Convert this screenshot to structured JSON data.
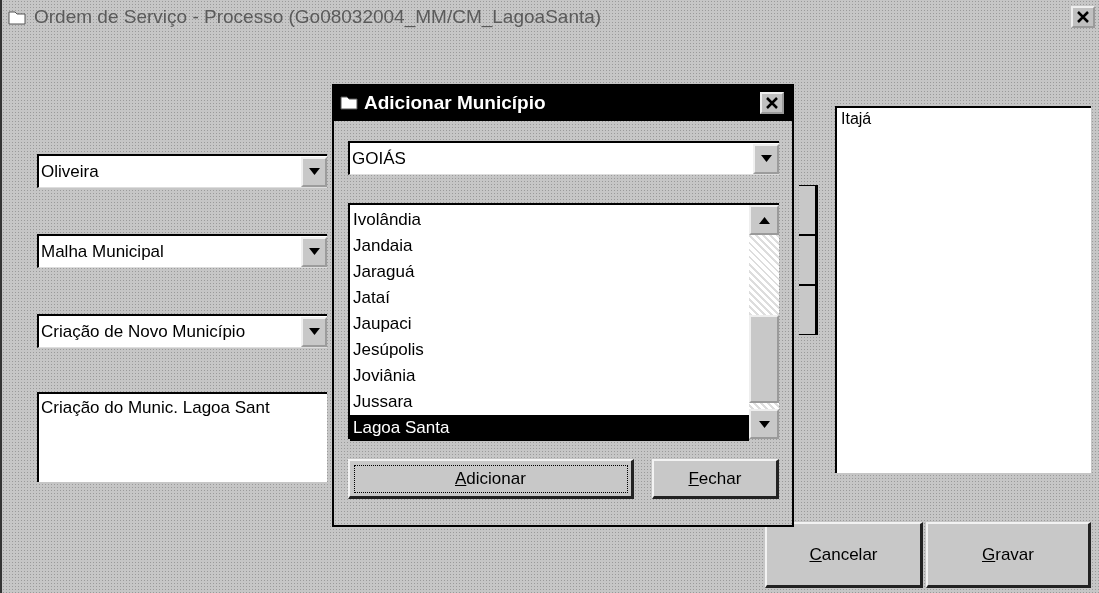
{
  "window": {
    "title": "Ordem de Serviço - Processo (Go08032004_MM/CM_LagoaSanta)",
    "active": false
  },
  "form": {
    "combos": [
      {
        "value": "Oliveira"
      },
      {
        "value": "Malha Municipal"
      },
      {
        "value": "Criação de Novo Município"
      }
    ],
    "description": "Criação do Munic. Lagoa Sant",
    "selected_list": {
      "items": [
        "Itajá"
      ]
    },
    "buttons": [
      {
        "label": "Cancelar"
      },
      {
        "label": "Gravar"
      }
    ]
  },
  "dialog": {
    "title": "Adicionar Município",
    "active": true,
    "state_combo": {
      "value": "GOIÁS"
    },
    "municipalities": [
      {
        "name": "Ivolândia",
        "selected": false
      },
      {
        "name": "Jandaia",
        "selected": false
      },
      {
        "name": "Jaraguá",
        "selected": false
      },
      {
        "name": "Jataí",
        "selected": false
      },
      {
        "name": "Jaupaci",
        "selected": false
      },
      {
        "name": "Jesúpolis",
        "selected": false
      },
      {
        "name": "Joviânia",
        "selected": false
      },
      {
        "name": "Jussara",
        "selected": false
      },
      {
        "name": "Lagoa Santa",
        "selected": true
      }
    ],
    "buttons": [
      {
        "label": "Adicionar",
        "focused": true
      },
      {
        "label": "Fechar",
        "focused": false
      }
    ]
  }
}
